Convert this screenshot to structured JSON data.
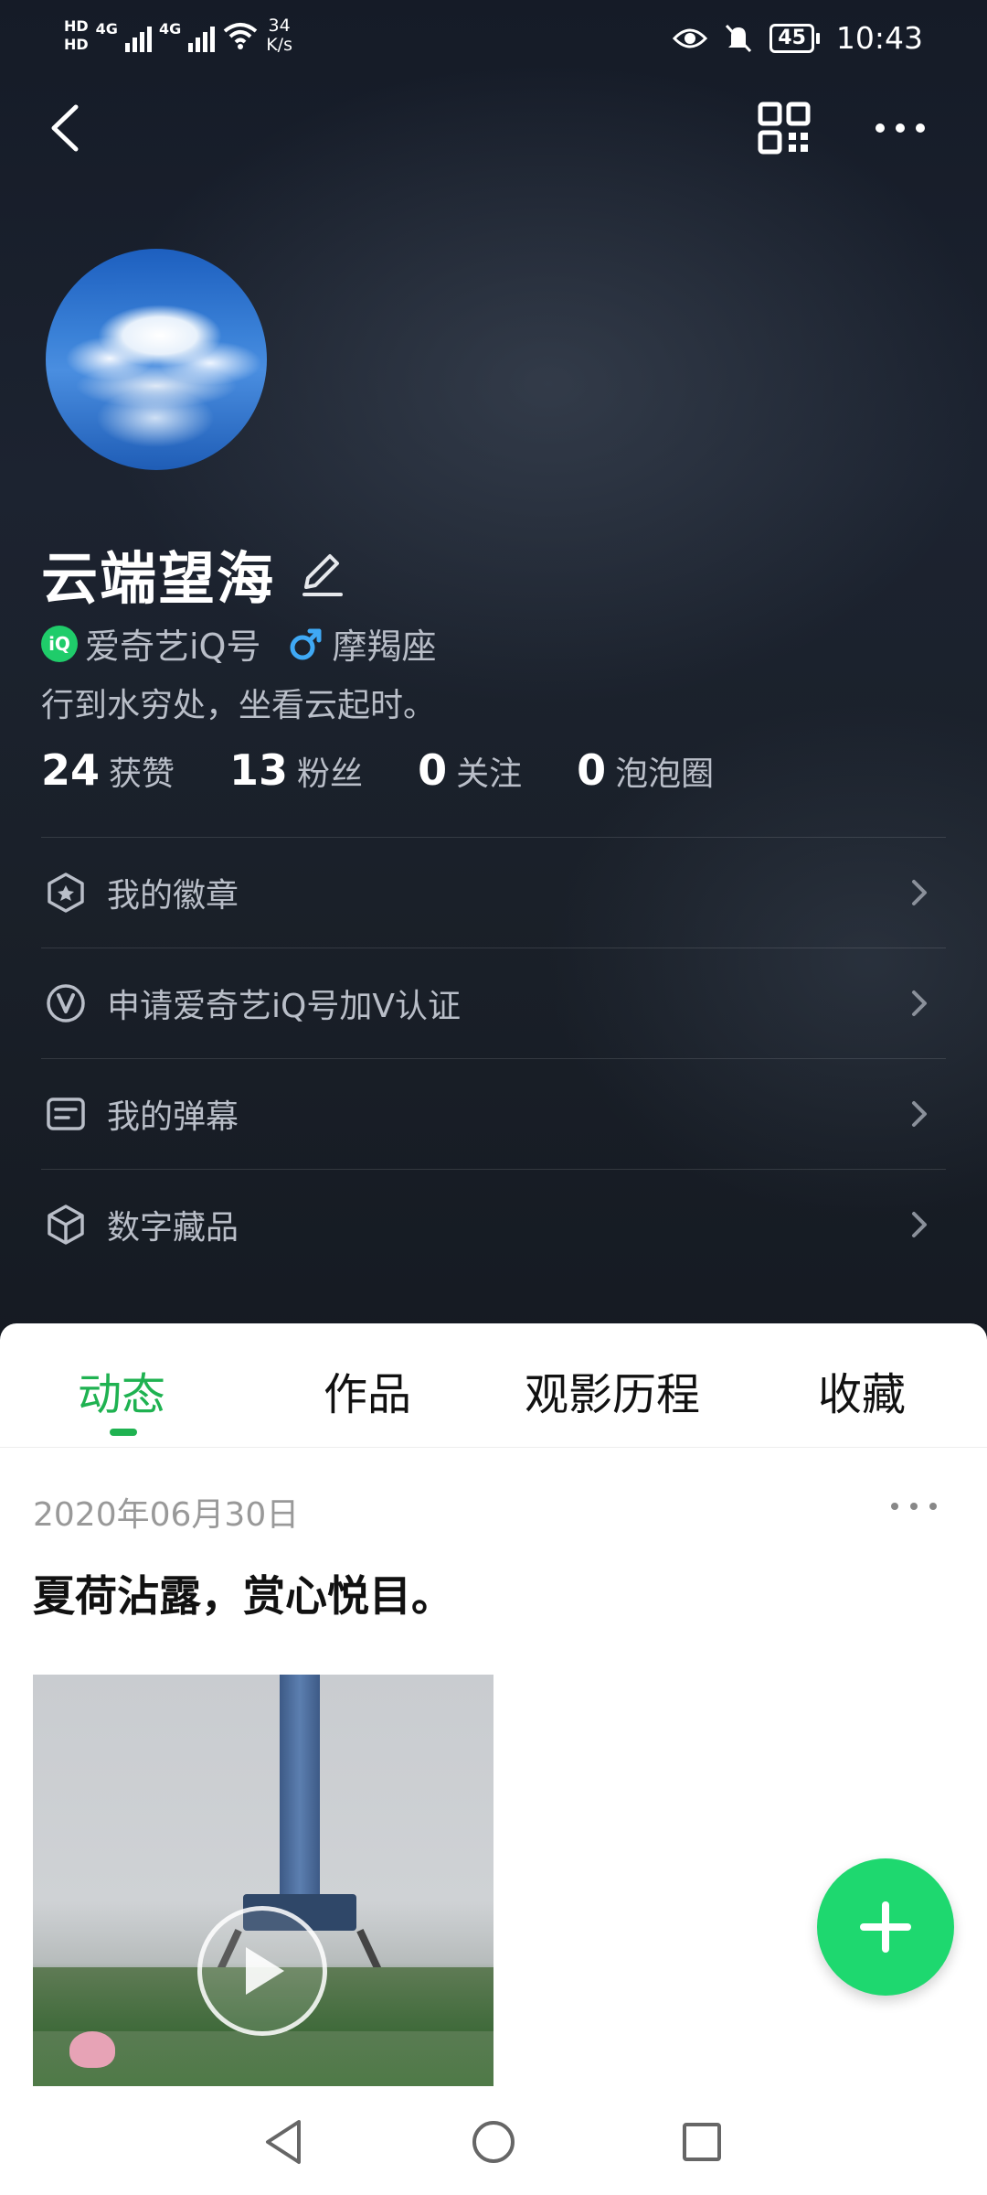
{
  "status_bar": {
    "hd1": "HD",
    "hd2": "HD",
    "net1": "4G",
    "net2": "4G",
    "speed_value": "34",
    "speed_unit": "K/s",
    "battery": "45",
    "time": "10:43"
  },
  "profile": {
    "username": "云端望海",
    "iq_badge": "iQ",
    "iq_label": "爱奇艺iQ号",
    "zodiac": "摩羯座",
    "bio": "行到水穷处，坐看云起时。",
    "stats": [
      {
        "num": "24",
        "label": "获赞"
      },
      {
        "num": "13",
        "label": "粉丝"
      },
      {
        "num": "0",
        "label": "关注"
      },
      {
        "num": "0",
        "label": "泡泡圈"
      }
    ]
  },
  "menu": {
    "items": [
      {
        "label": "我的徽章",
        "icon": "badge-icon"
      },
      {
        "label": "申请爱奇艺iQ号加V认证",
        "icon": "verify-v-icon"
      },
      {
        "label": "我的弹幕",
        "icon": "danmaku-icon"
      },
      {
        "label": "数字藏品",
        "icon": "cube-icon"
      }
    ]
  },
  "tabs": [
    {
      "label": "动态",
      "active": true
    },
    {
      "label": "作品",
      "active": false
    },
    {
      "label": "观影历程",
      "active": false
    },
    {
      "label": "收藏",
      "active": false
    }
  ],
  "post": {
    "date": "2020年06月30日",
    "text": "夏荷沾露，赏心悦目。"
  },
  "colors": {
    "accent_green": "#1fb251",
    "fab_green": "#1ed86f",
    "hero_bg": "#1c2330"
  }
}
